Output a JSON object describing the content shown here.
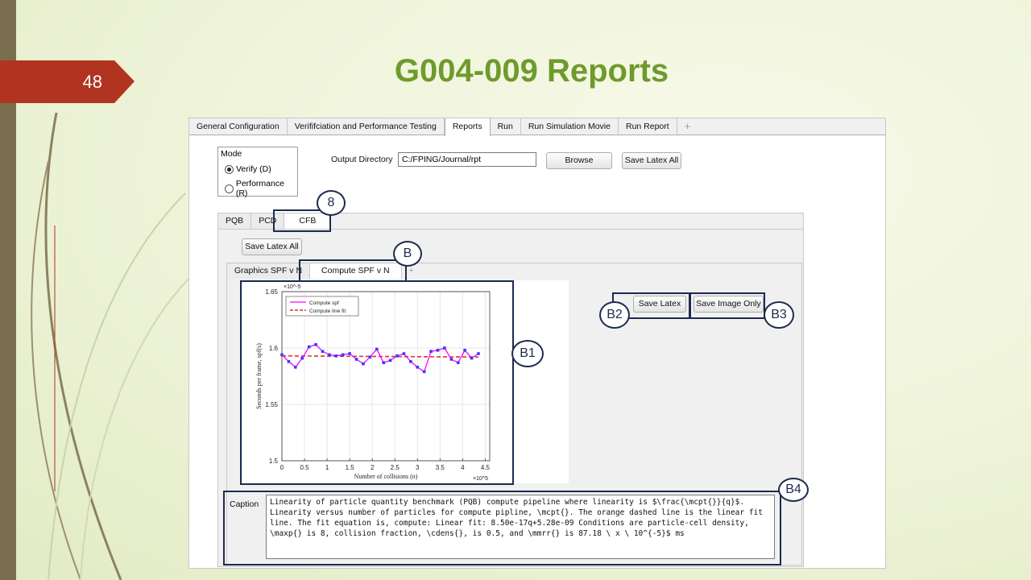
{
  "slide": {
    "number": "48",
    "title": "G004-009 Reports"
  },
  "window": {
    "tabs": [
      "General Configuration",
      "Verififciation and Performance Testing",
      "Reports",
      "Run",
      "Run Simulation Movie",
      "Run Report",
      "+"
    ],
    "active_tab": "Reports"
  },
  "mode": {
    "title": "Mode",
    "options": [
      {
        "label": "Verify (D)",
        "selected": true
      },
      {
        "label": "Performance (R)",
        "selected": false
      }
    ]
  },
  "output": {
    "label": "Output Directory",
    "value": "C:/FPING/Journal/rpt",
    "browse_label": "Browse",
    "save_all_label": "Save Latex All"
  },
  "sub_tabs": [
    "PQB",
    "PCD",
    "CFB"
  ],
  "sub_active": "CFB",
  "sub_save_all_label": "Save Latex All",
  "graph_tabs": [
    "Graphics SPF v N",
    "Compute SPF v N",
    "+"
  ],
  "graph_active": "Compute SPF v N",
  "buttons": {
    "save_latex": "Save Latex",
    "save_image_only": "Save Image Only"
  },
  "caption": {
    "label": "Caption",
    "text": "Linearity of particle quantity benchmark (PQB) compute pipeline where linearity is $\\frac{\\mcpt{}}{q}$. Linearity versus number of particles for compute pipline, \\mcpt{}. The orange dashed line is the linear fit line. The fit equation is, compute: Linear fit: 8.50e-17q+5.28e-09 Conditions are particle-cell density, \\maxp{} is 8, collision fraction, \\cdens{}, is 0.5, and \\mmrr{} is 87.18 \\ x \\ 10^{-5}$ ms"
  },
  "annotations": [
    "8",
    "B",
    "B1",
    "B2",
    "B3",
    "B4"
  ],
  "chart_data": {
    "type": "line",
    "xlabel": "Number of collisions (n)",
    "ylabel": "Seconds per frame, spf(s)",
    "x_exponent": "×10^5",
    "y_exponent": "×10^-5",
    "x_ticks": [
      "0",
      "0.5",
      "1",
      "1.5",
      "2",
      "2.5",
      "3",
      "3.5",
      "4",
      "4.5"
    ],
    "y_ticks": [
      "1.5",
      "1.55",
      "1.6",
      "1.65"
    ],
    "xlim": [
      0,
      4.6
    ],
    "ylim": [
      1.5,
      1.65
    ],
    "grid": true,
    "legend_placement": "top-left",
    "series": [
      {
        "name": "Compute spf",
        "color": "#ff00ff",
        "marker_color": "#3a3aff",
        "x": [
          0.0,
          0.15,
          0.3,
          0.45,
          0.6,
          0.75,
          0.9,
          1.05,
          1.2,
          1.35,
          1.5,
          1.65,
          1.8,
          1.95,
          2.1,
          2.25,
          2.4,
          2.55,
          2.7,
          2.85,
          3.0,
          3.15,
          3.3,
          3.45,
          3.6,
          3.75,
          3.9,
          4.05,
          4.2,
          4.35
        ],
        "y": [
          1.594,
          1.588,
          1.583,
          1.591,
          1.601,
          1.603,
          1.597,
          1.594,
          1.593,
          1.594,
          1.595,
          1.59,
          1.586,
          1.592,
          1.599,
          1.587,
          1.589,
          1.593,
          1.595,
          1.588,
          1.583,
          1.579,
          1.597,
          1.598,
          1.6,
          1.59,
          1.587,
          1.598,
          1.591,
          1.595
        ]
      },
      {
        "name": "Compute line fit",
        "color": "#e03030",
        "dashed": true,
        "x": [
          0.0,
          4.35
        ],
        "y": [
          1.593,
          1.592
        ]
      }
    ]
  }
}
